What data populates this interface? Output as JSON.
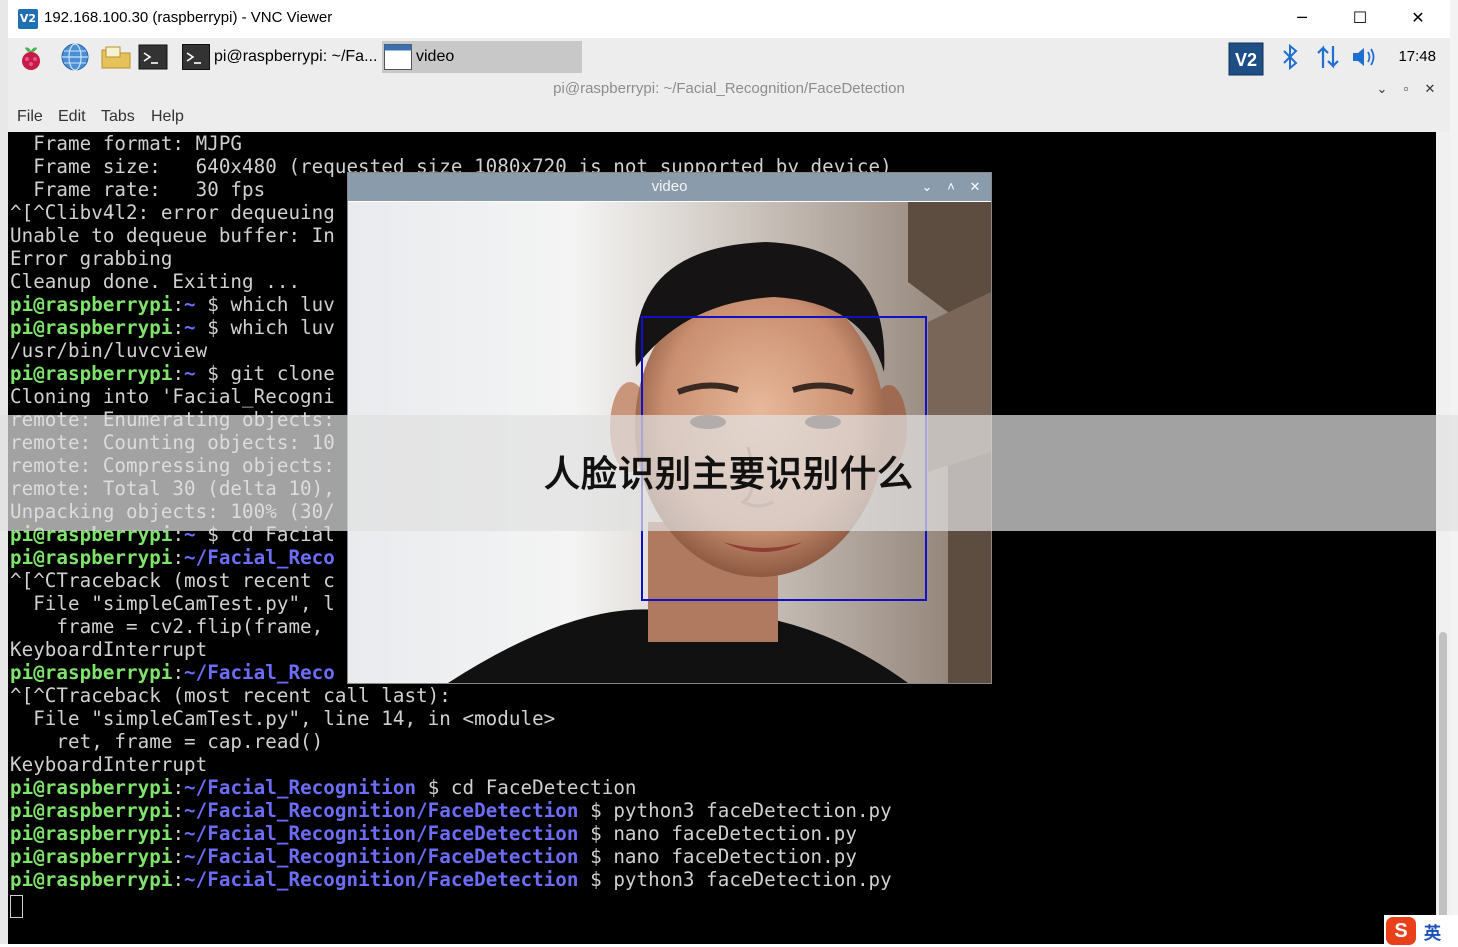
{
  "vnc": {
    "title": "192.168.100.30 (raspberrypi) - VNC Viewer",
    "logo_text": "V2",
    "minimize": "─",
    "maximize": "☐",
    "close": "✕"
  },
  "taskbar": {
    "tasks": [
      {
        "label": "pi@raspberrypi: ~/Fa...",
        "icon": "terminal-icon"
      },
      {
        "label": "video",
        "icon": "window-icon"
      }
    ],
    "clock": "17:48"
  },
  "terminal": {
    "title": "pi@raspberrypi: ~/Facial_Recognition/FaceDetection",
    "menu": [
      "File",
      "Edit",
      "Tabs",
      "Help"
    ],
    "lines": [
      {
        "t": "  Frame format: MJPG"
      },
      {
        "t": "  Frame size:   640x480 (requested size 1080x720 is not supported by device)"
      },
      {
        "t": "  Frame rate:   30 fps"
      },
      {
        "t": "^[^Clibv4l2: error dequeuing"
      },
      {
        "t": "Unable to dequeue buffer: In"
      },
      {
        "t": "Error grabbing"
      },
      {
        "t": "Cleanup done. Exiting ..."
      },
      {
        "u": "pi@raspberrypi",
        "p": "~",
        "c": " $ which luv"
      },
      {
        "u": "pi@raspberrypi",
        "p": "~",
        "c": " $ which luv"
      },
      {
        "t": "/usr/bin/luvcview"
      },
      {
        "u": "pi@raspberrypi",
        "p": "~",
        "c": " $ git clone"
      },
      {
        "t": "Cloning into 'Facial_Recogni"
      },
      {
        "t": "remote: Enumerating objects:"
      },
      {
        "t": "remote: Counting objects: 10"
      },
      {
        "t": "remote: Compressing objects:"
      },
      {
        "t": "remote: Total 30 (delta 10),"
      },
      {
        "t": "Unpacking objects: 100% (30/"
      },
      {
        "u": "pi@raspberrypi",
        "p": "~",
        "c": " $ cd Facial"
      },
      {
        "u": "pi@raspberrypi",
        "p": "~/Facial_Reco",
        "c": ""
      },
      {
        "t": "^[^CTraceback (most recent c"
      },
      {
        "t": "  File \"simpleCamTest.py\", l"
      },
      {
        "t": "    frame = cv2.flip(frame,"
      },
      {
        "t": "KeyboardInterrupt"
      },
      {
        "u": "pi@raspberrypi",
        "p": "~/Facial_Reco",
        "c": ""
      },
      {
        "t": "^[^CTraceback (most recent call last):"
      },
      {
        "t": "  File \"simpleCamTest.py\", line 14, in <module>"
      },
      {
        "t": "    ret, frame = cap.read()"
      },
      {
        "t": "KeyboardInterrupt"
      },
      {
        "u": "pi@raspberrypi",
        "p": "~/Facial_Recognition",
        "c": " $ cd FaceDetection"
      },
      {
        "u": "pi@raspberrypi",
        "p": "~/Facial_Recognition/FaceDetection",
        "c": " $ python3 faceDetection.py"
      },
      {
        "u": "pi@raspberrypi",
        "p": "~/Facial_Recognition/FaceDetection",
        "c": " $ nano faceDetection.py"
      },
      {
        "u": "pi@raspberrypi",
        "p": "~/Facial_Recognition/FaceDetection",
        "c": " $ nano faceDetection.py"
      },
      {
        "u": "pi@raspberrypi",
        "p": "~/Facial_Recognition/FaceDetection",
        "c": " $ python3 faceDetection.py"
      }
    ]
  },
  "video_window": {
    "title": "video",
    "menu_glyph": "⌄",
    "max_glyph": "˄",
    "close_glyph": "✕"
  },
  "banner": {
    "text": "人脸识别主要识别什么"
  },
  "ime": {
    "logo": "S",
    "lang": "英"
  },
  "colors": {
    "prompt_user": "#7fe36b",
    "prompt_path": "#6c6cf7",
    "face_box": "#1010c8"
  }
}
